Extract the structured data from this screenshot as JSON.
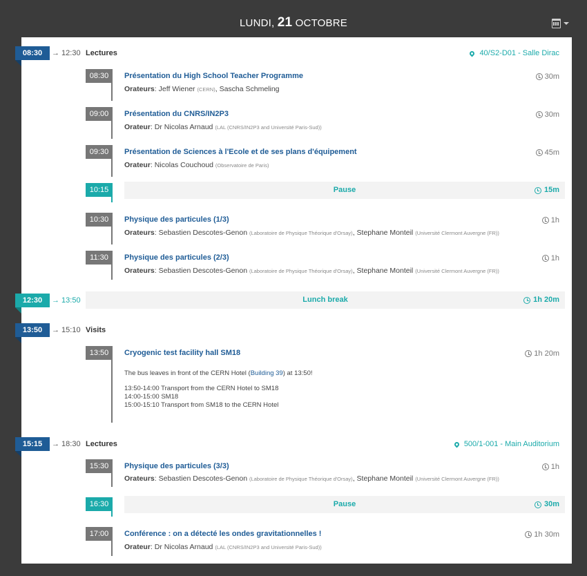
{
  "header": {
    "weekday": "LUNDI,",
    "day": "21",
    "month": "OCTOBRE",
    "calendar_icon": "calendar-icon"
  },
  "blocks": [
    {
      "start": "08:30",
      "end": "→ 12:30",
      "title": "Lectures",
      "location": "40/S2-D01 - Salle Dirac"
    },
    {
      "start": "12:30",
      "end": "→ 13:50",
      "title": "Lunch break",
      "duration": "1h 20m"
    },
    {
      "start": "13:50",
      "end": "→ 15:10",
      "title": "Visits"
    },
    {
      "start": "15:15",
      "end": "→ 18:30",
      "title": "Lectures",
      "location": "500/1-001 - Main Auditorium"
    }
  ],
  "contributions": [
    {
      "time": "08:30",
      "title": "Présentation du High School Teacher Programme",
      "speaker_label": "Orateurs",
      "speakers": [
        {
          "name": "Jeff Wiener",
          "aff": "(CERN)"
        },
        {
          "name": "Sascha Schmeling",
          "aff": ""
        }
      ],
      "duration": "30m"
    },
    {
      "time": "09:00",
      "title": "Présentation du CNRS/IN2P3",
      "speaker_label": "Orateur",
      "speakers": [
        {
          "name": "Dr Nicolas Arnaud",
          "aff": "(LAL (CNRS/IN2P3 and Université Paris-Sud))"
        }
      ],
      "duration": "30m"
    },
    {
      "time": "09:30",
      "title": "Présentation de Sciences à l'Ecole et de ses plans d'équipement",
      "speaker_label": "Orateur",
      "speakers": [
        {
          "name": "Nicolas Couchoud",
          "aff": "(Observatoire de Paris)"
        }
      ],
      "duration": "45m"
    },
    {
      "time": "10:15",
      "title": "Pause",
      "duration": "15m"
    },
    {
      "time": "10:30",
      "title": "Physique des particules (1/3)",
      "speaker_label": "Orateurs",
      "speakers": [
        {
          "name": "Sebastien Descotes-Genon",
          "aff": "(Laboratoire de Physique Théorique d'Orsay)"
        },
        {
          "name": "Stephane Monteil",
          "aff": "(Université Clermont Auvergne (FR))"
        }
      ],
      "duration": "1h"
    },
    {
      "time": "11:30",
      "title": "Physique des particules (2/3)",
      "speaker_label": "Orateurs",
      "speakers": [
        {
          "name": "Sebastien Descotes-Genon",
          "aff": "(Laboratoire de Physique Théorique d'Orsay)"
        },
        {
          "name": "Stephane Monteil",
          "aff": "(Université Clermont Auvergne (FR))"
        }
      ],
      "duration": "1h"
    },
    {
      "time": "13:50",
      "title": "Cryogenic test facility hall SM18",
      "duration": "1h 20m",
      "desc_pre": "The bus leaves in front of the CERN Hotel (",
      "desc_link": "Building 39",
      "desc_post": ") at 13:50!",
      "desc_lines": [
        "13:50-14:00 Transport from the CERN Hotel to SM18",
        "14:00-15:00 SM18",
        "15:00-15:10 Transport from SM18 to the CERN Hotel"
      ]
    },
    {
      "time": "15:30",
      "title": "Physique des particules (3/3)",
      "speaker_label": "Orateurs",
      "speakers": [
        {
          "name": "Sebastien Descotes-Genon",
          "aff": "(Laboratoire de Physique Théorique d'Orsay)"
        },
        {
          "name": "Stephane Monteil",
          "aff": "(Université Clermont Auvergne (FR))"
        }
      ],
      "duration": "1h"
    },
    {
      "time": "16:30",
      "title": "Pause",
      "duration": "30m"
    },
    {
      "time": "17:00",
      "title": "Conférence : on a détecté les ondes gravitationnelles !",
      "speaker_label": "Orateur",
      "speakers": [
        {
          "name": "Dr Nicolas Arnaud",
          "aff": "(LAL (CNRS/IN2P3 and Université Paris-Sud))"
        }
      ],
      "duration": "1h 30m"
    }
  ],
  "colors": {
    "session": "#1f5c96",
    "break": "#1baaaa",
    "contribution": "#777777",
    "link": "#1f5c96"
  }
}
